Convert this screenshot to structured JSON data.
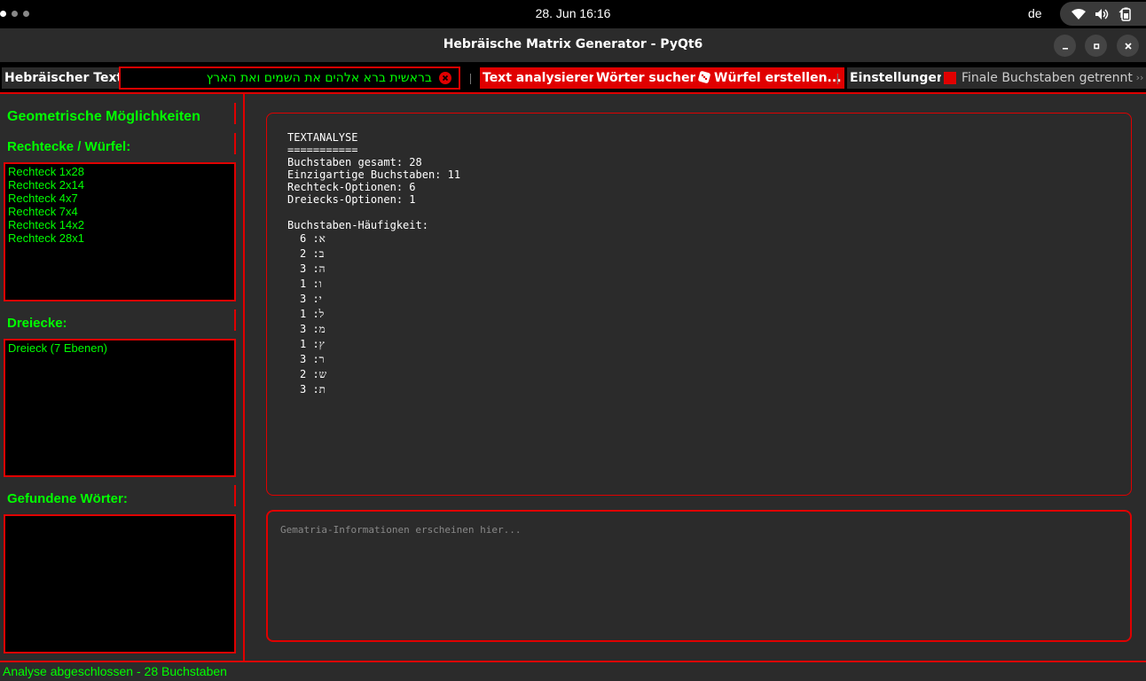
{
  "system": {
    "clock": "28. Jun  16:16",
    "language": "de",
    "tray_icons": [
      "wifi-icon",
      "speaker-icon",
      "battery-icon"
    ]
  },
  "window": {
    "title": "Hebräische Matrix Generator - PyQt6"
  },
  "toolbar": {
    "text_label": "Hebräischer Text:",
    "text_value": "בראשית ברא אלהים את השמים ואת הארץ",
    "analyze_button": "Text analysieren",
    "search_button": "Wörter suchen",
    "cube_button": "Würfel erstellen...",
    "settings_label": "Einstellungen:",
    "finale_checkbox_label": "Finale Buchstaben getrennt"
  },
  "left_panel": {
    "title": "Geometrische Möglichkeiten",
    "rect_title": "Rechtecke / Würfel:",
    "rectangles": [
      "Rechteck 1x28",
      "Rechteck 2x14",
      "Rechteck 4x7",
      "Rechteck 7x4",
      "Rechteck 14x2",
      "Rechteck 28x1"
    ],
    "tri_title": "Dreiecke:",
    "triangles": [
      "Dreieck (7 Ebenen)"
    ],
    "words_title": "Gefundene Wörter:",
    "words": []
  },
  "analysis": {
    "lines": [
      "TEXTANALYSE",
      "===========",
      "Buchstaben gesamt: 28",
      "Einzigartige Buchstaben: 11",
      "Rechteck-Optionen: 6",
      "Dreiecks-Optionen: 1"
    ],
    "freq_title": "Buchstaben-Häufigkeit:",
    "frequencies": [
      "א: 6",
      "ב: 2",
      "ה: 3",
      "ו: 1",
      "י: 3",
      "ל: 1",
      "מ: 3",
      "ץ: 1",
      "ר: 3",
      "ש: 2",
      "ת: 3"
    ]
  },
  "gematria": {
    "placeholder": "Gematria-Informationen erscheinen hier..."
  },
  "status": {
    "text": "Analyse abgeschlossen - 28 Buchstaben"
  },
  "colors": {
    "accent_red": "#e00000",
    "text_green": "#00ff00",
    "panel_bg": "#2b2b2b"
  }
}
